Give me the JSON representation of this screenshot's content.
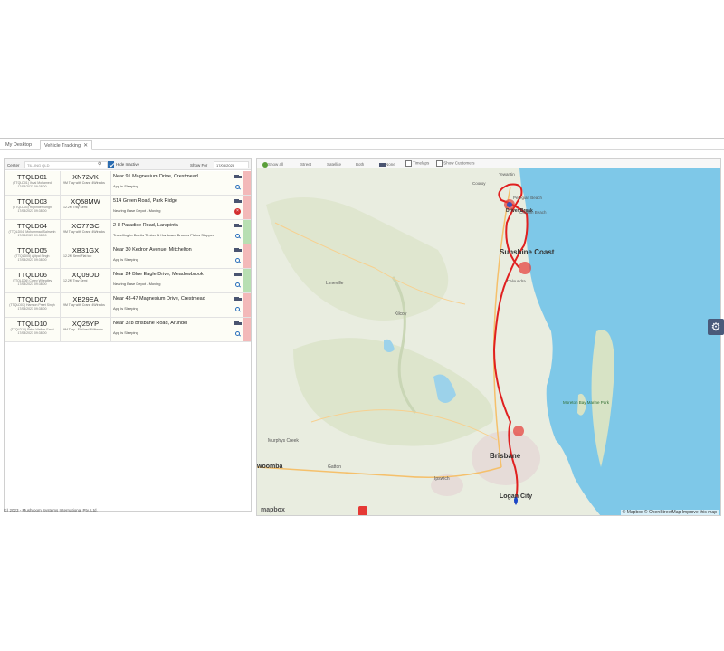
{
  "tabs": [
    {
      "label": "My Desktop"
    },
    {
      "label": "Vehicle Tracking"
    }
  ],
  "filter": {
    "center_label": "Center",
    "center_placeholder": "TILLING QLD",
    "hide_inactive_label": "Hide Inactive",
    "show_for_label": "Show For",
    "date_value": "17/08/2023"
  },
  "vehicles": [
    {
      "id": "TTQLD01",
      "driver": "(TTQLD01) Ihsai Mohamed",
      "time": "17/08/2023 09:38:00",
      "plate": "XN72VK",
      "desc": "9M Tray with Crane 4Wtracks",
      "location": "Near 91 Magnesium Drive, Crestmead",
      "status": "App is Sleeping",
      "action": "mag",
      "strip": "red"
    },
    {
      "id": "TTQLD03",
      "driver": "(TTQLD03) Rupinder Singh",
      "time": "17/08/2023 09:38:00",
      "plate": "XQ58MW",
      "desc": "12.2M Tray Semi",
      "location": "514 Green Road, Park Ridge",
      "status": "Nearing Base Depot - Moving",
      "action": "alert",
      "strip": "red"
    },
    {
      "id": "TTQLD04",
      "driver": "(TTQLD04) Mohammad Salmanh",
      "time": "17/08/2023 09:38:00",
      "plate": "XO77GC",
      "desc": "9M Tray with Crane 4Wtracks",
      "location": "2-8 Paradise Road, Larapinta",
      "status": "Travelling to Beetts Timber & Hardware Browns Plains Stopped",
      "action": "mag",
      "strip": "green"
    },
    {
      "id": "TTQLD05",
      "driver": "(TTQLD05) Ajitpal Singh",
      "time": "17/08/2023 09:38:00",
      "plate": "XB31GX",
      "desc": "12.2M Semi Flat top",
      "location": "Near 30 Kedron Avenue, Mitchelton",
      "status": "App is Sleeping",
      "action": "mag",
      "strip": "red"
    },
    {
      "id": "TTQLD06",
      "driver": "(TTQLD06) Corey Wheatley",
      "time": "17/08/2023 09:38:00",
      "plate": "XQ09DD",
      "desc": "12.2M Tray Semi",
      "location": "Near 24 Blue Eagle Drive, Meadowbrook",
      "status": "Nearing Base Depot - Moving",
      "action": "mag",
      "strip": "green"
    },
    {
      "id": "TTQLD07",
      "driver": "(TTQLD07) Harmon Preet Singh",
      "time": "17/08/2023 09:38:00",
      "plate": "XB29EA",
      "desc": "9M Tray with Crane 4Wtracks",
      "location": "Near 43-47 Magnesium Drive, Crestmead",
      "status": "App is Sleeping",
      "action": "mag",
      "strip": "red"
    },
    {
      "id": "TTQLD10",
      "driver": "(TTQLD10) Peter Walker-Ernst",
      "time": "17/08/2023 09:38:00",
      "plate": "XQ25YP",
      "desc": "9M Tray - Flat bed 4Wtracks",
      "location": "Near 328 Brisbane Road, Arundel",
      "status": "App is Sleeping",
      "action": "mag",
      "strip": "red"
    }
  ],
  "map": {
    "toolbar": {
      "show_all": "Show all",
      "street": "Street",
      "satellite": "Satellite",
      "both": "Both",
      "none": "None",
      "timelaps": "Timelaps",
      "show_customers": "Show Customers"
    },
    "labels": {
      "sunshine_coast": "Sunshine Coast",
      "brisbane": "Brisbane",
      "logan_city": "Logan City",
      "limeville": "Limeville",
      "kilcoy": "Kilcoy",
      "murphys_creek": "Murphys Creek",
      "gatton": "Gatton",
      "ipswich": "Ipswich",
      "toowoomba": "woomba",
      "caloundra": "Caloundra",
      "coolum": "Coolum Beach",
      "peregian": "Peregian Beach",
      "cooroy": "Cooroy",
      "tewantin": "Tewantin",
      "moreton_bay": "Moreton Bay Marine Park",
      "driver_break": "Driver Break"
    },
    "attribution": "© Mapbox © OpenStreetMap Improve this map",
    "logo": "mapbox",
    "colors": {
      "water": "#7ec8e8",
      "land": "#e9ede0",
      "route": "#e02020"
    }
  },
  "footer": "(c) 2023 - Mushroom Systems International Pty. Ltd."
}
